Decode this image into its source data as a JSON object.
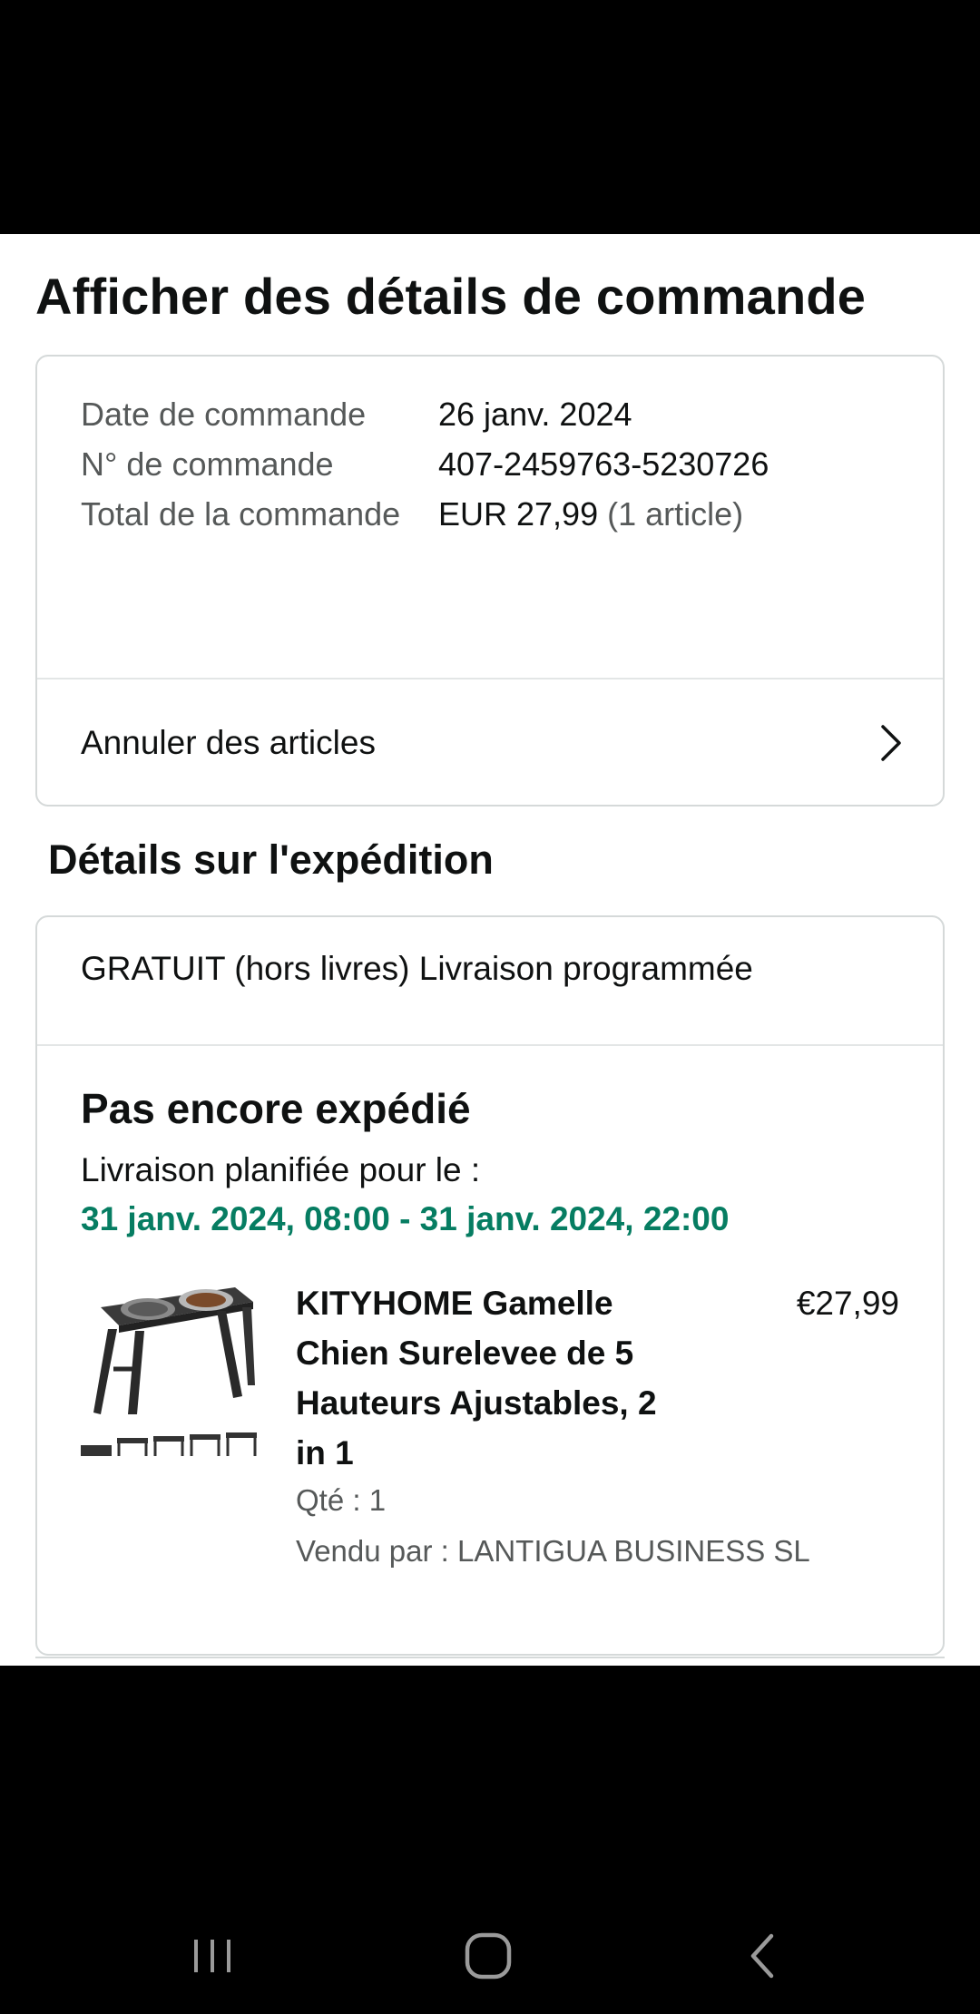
{
  "page": {
    "title": "Afficher des détails de commande"
  },
  "order": {
    "date_label": "Date de commande",
    "date_value": "26 janv. 2024",
    "number_label": "N° de commande",
    "number_value": "407-2459763-5230726",
    "total_label": "Total de la commande",
    "total_value": "EUR 27,99",
    "total_items": "(1 article)",
    "cancel_label": "Annuler des articles"
  },
  "shipping": {
    "section_title": "Détails sur l'expédition",
    "method": "GRATUIT (hors livres) Livraison programmée",
    "status": "Pas encore expédié",
    "planned_label": "Livraison planifiée pour le :",
    "planned_window": "31 janv. 2024, 08:00 - 31 janv. 2024, 22:00",
    "date_color": "#067d62"
  },
  "product": {
    "title": "KITYHOME Gamelle Chien Surelevee de 5 Hauteurs Ajustables, 2 in 1",
    "price": "€27,99",
    "quantity": "Qté : 1",
    "seller": "Vendu par : LANTIGUA BUSINESS SL",
    "image_icon": "elevated-dog-bowl-image"
  },
  "system_nav": {
    "recents_icon": "recent-apps-icon",
    "home_icon": "home-icon",
    "back_icon": "back-icon"
  }
}
